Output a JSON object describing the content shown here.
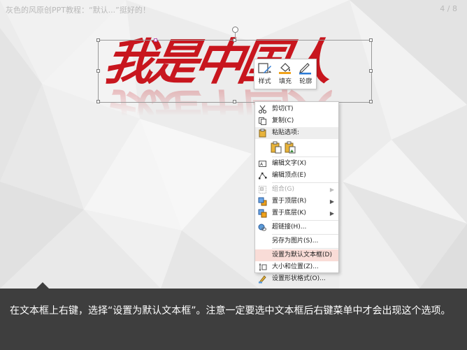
{
  "header": {
    "title": "灰色的风原创PPT教程：“默认...”挺好的！",
    "page": "4 / 8"
  },
  "wordart": {
    "text": "我是中国人",
    "color": "#c8161e"
  },
  "mini_toolbar": {
    "style_label": "样式",
    "fill_label": "填充",
    "outline_label": "轮廓"
  },
  "context_menu": {
    "cut": "剪切(T)",
    "copy": "复制(C)",
    "paste_options": "粘贴选项:",
    "edit_text": "编辑文字(X)",
    "edit_points": "编辑顶点(E)",
    "group": "组合(G)",
    "bring_to_front": "置于顶层(R)",
    "send_to_back": "置于底层(K)",
    "hyperlink": "超链接(H)...",
    "save_as_picture": "另存为图片(S)...",
    "set_default_textbox": "设置为默认文本框(D)",
    "size_position": "大小和位置(Z)...",
    "format_shape": "设置形状格式(O)..."
  },
  "caption": {
    "text": "在文本框上右键，选择“设置为默认文本框”。注意一定要选中文本框后右键菜单中才会出现这个选项。"
  },
  "colors": {
    "highlight": "#f9dcd7",
    "caption_bg": "#3e3e3e",
    "accent_red": "#c8161e"
  }
}
